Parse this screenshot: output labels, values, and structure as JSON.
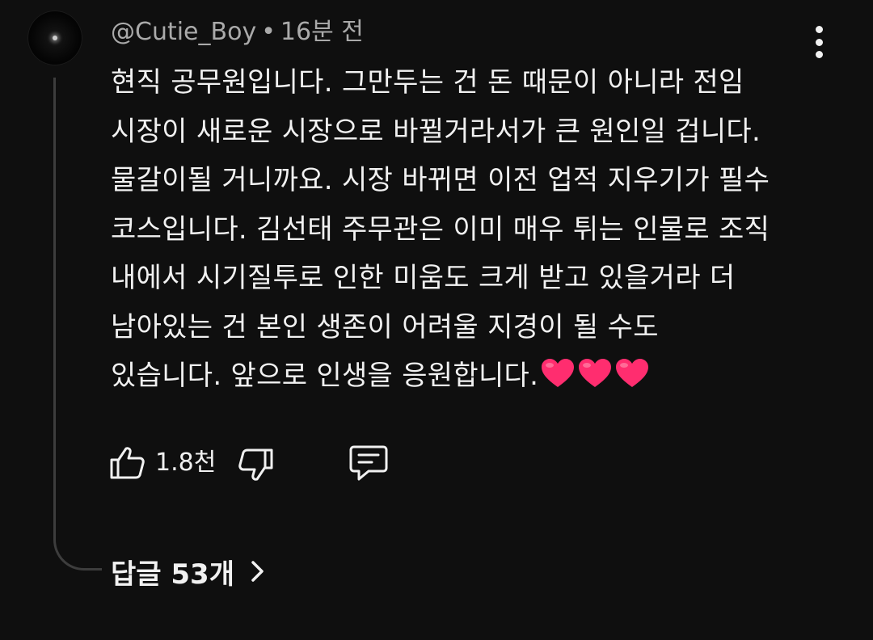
{
  "comment": {
    "author": "@Cutie_Boy",
    "separator": "•",
    "timestamp": "16분 전",
    "lines": [
      "현직 공무원입니다. 그만두는 건 돈 때문이 아니라 전임",
      "시장이 새로운 시장으로 바뀔거라서가 큰 원인일 겁니다.",
      "물갈이될 거니까요. 시장 바뀌면 이전 업적 지우기가 필수",
      "코스입니다. 김선태 주무관은 이미 매우 튀는 인물로 조직",
      "내에서 시기질투로 인한 미움도 크게 받고 있을거라 더",
      "남아있는 건 본인 생존이 어려울 지경이 될 수도",
      "있습니다. 앞으로 인생을 응원합니다."
    ],
    "emoji": [
      "heart-icon",
      "heart-icon",
      "heart-icon"
    ],
    "heart_color": "#ff2d6f"
  },
  "actions": {
    "like_count": "1.8천",
    "like_icon": "thumbs-up-icon",
    "dislike_icon": "thumbs-down-icon",
    "reply_icon": "comment-icon"
  },
  "replies": {
    "label": "답글 53개",
    "icon": "chevron-right-icon"
  },
  "colors": {
    "background": "#0f0f0f",
    "text": "#f1f1f1",
    "meta_text": "#aaaaaa",
    "thread_line": "#3d3d3d"
  }
}
